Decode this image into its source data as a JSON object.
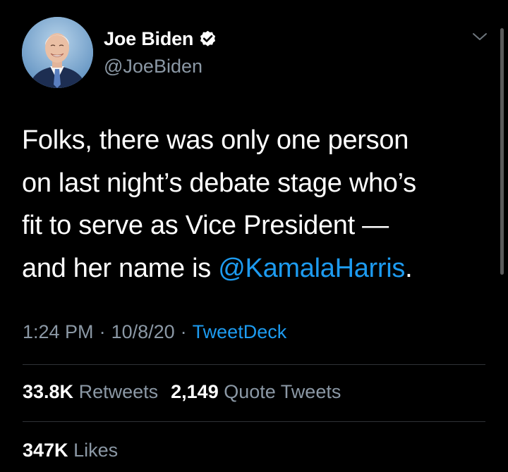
{
  "author": {
    "display_name": "Joe Biden",
    "handle": "@JoeBiden",
    "verified_icon": "verified-badge-icon",
    "avatar": "profile-photo"
  },
  "tweet": {
    "lines": [
      "Folks, there was only one person",
      "on last night’s debate stage who’s",
      "fit to serve as Vice President —",
      "and her name is "
    ],
    "mention": "@KamalaHarris",
    "mention_suffix": "."
  },
  "meta": {
    "time": "1:24 PM",
    "separator": "·",
    "date": "10/8/20",
    "source": "TweetDeck"
  },
  "stats": {
    "retweets_count": "33.8K",
    "retweets_label": "Retweets",
    "quotes_count": "2,149",
    "quotes_label": "Quote Tweets",
    "likes_count": "347K",
    "likes_label": "Likes"
  },
  "colors": {
    "background": "#000000",
    "text": "#ffffff",
    "secondary": "#8b98a5",
    "link": "#1d9bf0",
    "divider": "#2f3336"
  }
}
